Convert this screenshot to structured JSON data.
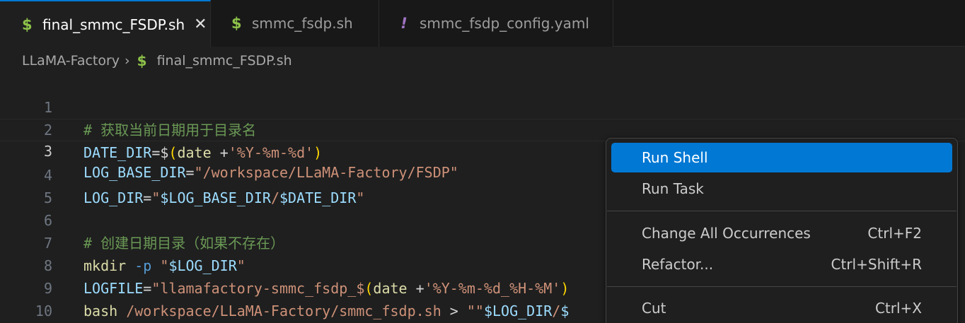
{
  "tabs": [
    {
      "icon": "$",
      "label": "final_smmc_FSDP.sh",
      "close": "✕"
    },
    {
      "icon": "$",
      "label": "smmc_fsdp.sh"
    },
    {
      "icon": "!",
      "label": "smmc_fsdp_config.yaml"
    }
  ],
  "breadcrumb": {
    "folder": "LLaMA-Factory",
    "separator": "›",
    "file_icon": "$",
    "file": "final_smmc_FSDP.sh"
  },
  "editor": {
    "line_numbers": [
      "1",
      "2",
      "3",
      "4",
      "5",
      "6",
      "7",
      "8",
      "9",
      "10"
    ],
    "lines": {
      "l1": {
        "comment": "# 获取当前日期用于目录名"
      },
      "l2": {
        "var": "DATE_DIR",
        "eq": "=",
        "dollar": "$",
        "open": "(",
        "cmd": "date ",
        "plus": "+",
        "fmt": "'%Y-%m-%d'",
        "close": ")"
      },
      "l3": {
        "var": "LOG_BASE_DIR",
        "eq": "=",
        "str": "\"/workspace/LLaMA-Factory/FSDP\""
      },
      "l4": {
        "var": "LOG_DIR",
        "eq": "=",
        "q1": "\"",
        "ref1": "$LOG_BASE_DIR",
        "slash": "/",
        "ref2": "$DATE_DIR",
        "q2": "\""
      },
      "l6": {
        "comment": "# 创建日期目录（如果不存在）"
      },
      "l7": {
        "cmd": "mkdir",
        "flag": " -p",
        "q1": " \"",
        "ref": "$LOG_DIR",
        "q2": "\""
      },
      "l8": {
        "var": "LOGFILE",
        "eq": "=",
        "str": "\"llamafactory-smmc_fsdp_",
        "dollar": "$",
        "open": "(",
        "cmd": "date ",
        "plus": "+",
        "fmt": "'%Y-%m-%d_%H-%M'",
        "close": ")"
      },
      "l9": {
        "cmd": "bash",
        "path": " /workspace/LLaMA-Factory/smmc_fsdp.sh",
        "redir": " > ",
        "q": "\"\"",
        "ref1": "$LOG_DIR",
        "slash": "/",
        "ref2": "$"
      }
    }
  },
  "context_menu": {
    "items": [
      {
        "label": "Run Shell",
        "shortcut": ""
      },
      {
        "label": "Run Task",
        "shortcut": ""
      },
      {
        "label": "Change All Occurrences",
        "shortcut": "Ctrl+F2"
      },
      {
        "label": "Refactor...",
        "shortcut": "Ctrl+Shift+R"
      },
      {
        "label": "Cut",
        "shortcut": "Ctrl+X"
      }
    ]
  }
}
